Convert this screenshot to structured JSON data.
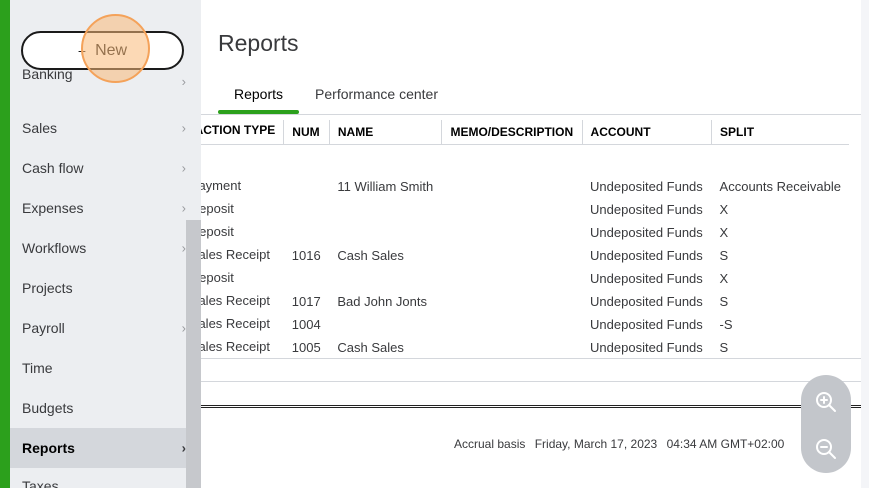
{
  "sidebar": {
    "new_button": {
      "plus": "+",
      "label": "New"
    },
    "items": [
      {
        "label": "Banking",
        "chevron": true
      },
      {
        "label": "Sales",
        "chevron": true
      },
      {
        "label": "Cash flow",
        "chevron": true
      },
      {
        "label": "Expenses",
        "chevron": true
      },
      {
        "label": "Workflows",
        "chevron": true
      },
      {
        "label": "Projects",
        "chevron": false
      },
      {
        "label": "Payroll",
        "chevron": true
      },
      {
        "label": "Time",
        "chevron": false
      },
      {
        "label": "Budgets",
        "chevron": false
      },
      {
        "label": "Reports",
        "chevron": true,
        "active": true
      },
      {
        "label": "Taxes",
        "chevron": false
      }
    ],
    "chevron_glyph": "›"
  },
  "main": {
    "title": "Reports",
    "tabs": [
      {
        "label": "Reports",
        "active": true
      },
      {
        "label": "Performance center",
        "active": false
      }
    ],
    "table": {
      "columns": [
        "TRANSACTION TYPE",
        "NUM",
        "NAME",
        "MEMO/DESCRIPTION",
        "ACCOUNT",
        "SPLIT"
      ],
      "rows": [
        [
          "Payment",
          "",
          "11 William Smith",
          "",
          "Undeposited Funds",
          "Accounts Receivable"
        ],
        [
          "Deposit",
          "",
          "",
          "",
          "Undeposited Funds",
          "X"
        ],
        [
          "Deposit",
          "",
          "",
          "",
          "Undeposited Funds",
          "X"
        ],
        [
          "Sales Receipt",
          "1016",
          "Cash Sales",
          "",
          "Undeposited Funds",
          "S"
        ],
        [
          "Deposit",
          "",
          "",
          "",
          "Undeposited Funds",
          "X"
        ],
        [
          "Sales Receipt",
          "1017",
          "Bad John Jonts",
          "",
          "Undeposited Funds",
          "S"
        ],
        [
          "Sales Receipt",
          "1004",
          "",
          "",
          "Undeposited Funds",
          "-S"
        ],
        [
          "Sales Receipt",
          "1005",
          "Cash Sales",
          "",
          "Undeposited Funds",
          "S"
        ]
      ]
    },
    "footer": {
      "basis": "Accrual basis",
      "datetime": "Friday, March 17, 2023",
      "time": "04:34 AM GMT+02:00"
    }
  },
  "zoom": {
    "in_icon": "zoom-in-icon",
    "out_icon": "zoom-out-icon"
  },
  "colors": {
    "brand_green": "#2ca01c",
    "highlight": "#f4a25a",
    "sidebar_bg": "#eceef1",
    "active_bg": "#d4d7dc"
  }
}
